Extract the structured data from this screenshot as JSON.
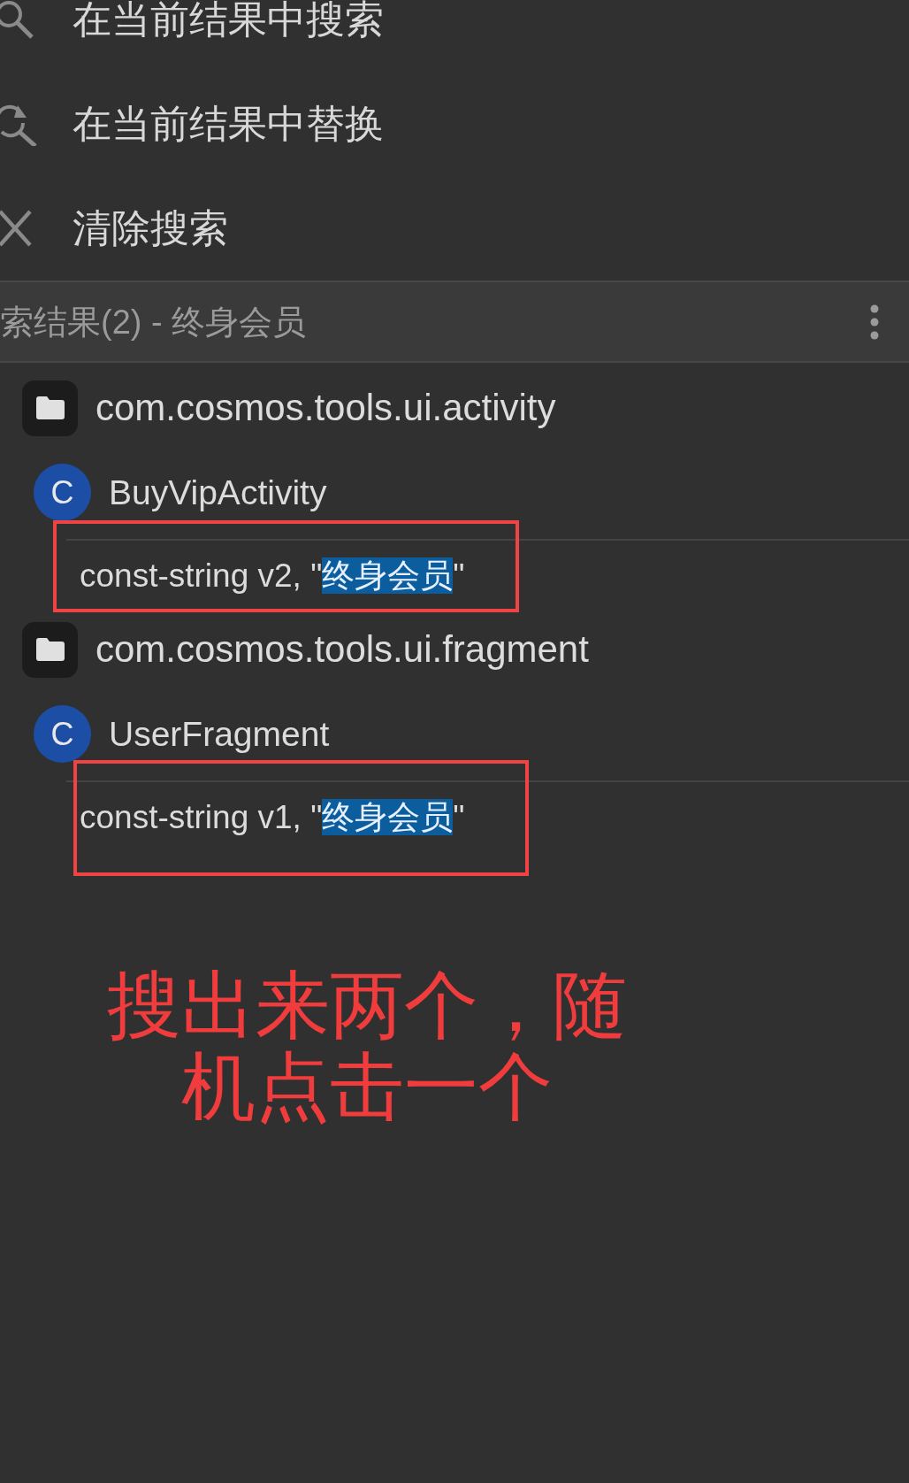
{
  "menu": [
    {
      "kind": "search",
      "label": "在当前结果中搜索"
    },
    {
      "kind": "replace",
      "label": "在当前结果中替换"
    },
    {
      "kind": "clear",
      "label": "清除搜索"
    }
  ],
  "results_header": {
    "title": "索结果(2) - 终身会员"
  },
  "results": [
    {
      "kind": "package",
      "name": "com.cosmos.tools.ui.activity",
      "children": [
        {
          "kind": "class",
          "badge": "C",
          "name": "BuyVipActivity",
          "children": [
            {
              "kind": "match",
              "parts": [
                {
                  "text": "const-string v2, \"",
                  "highlighted": false
                },
                {
                  "text": "终身会员",
                  "highlighted": true
                },
                {
                  "text": "\"",
                  "highlighted": false
                }
              ]
            }
          ]
        }
      ]
    },
    {
      "kind": "package",
      "name": "com.cosmos.tools.ui.fragment",
      "children": [
        {
          "kind": "class",
          "badge": "C",
          "name": "UserFragment",
          "children": [
            {
              "kind": "match",
              "parts": [
                {
                  "text": "const-string v1, \"",
                  "highlighted": false
                },
                {
                  "text": "终身会员",
                  "highlighted": true
                },
                {
                  "text": "\"",
                  "highlighted": false
                }
              ]
            }
          ]
        }
      ]
    }
  ],
  "annotation": {
    "text": "搜出来两个，随机点击一个"
  }
}
